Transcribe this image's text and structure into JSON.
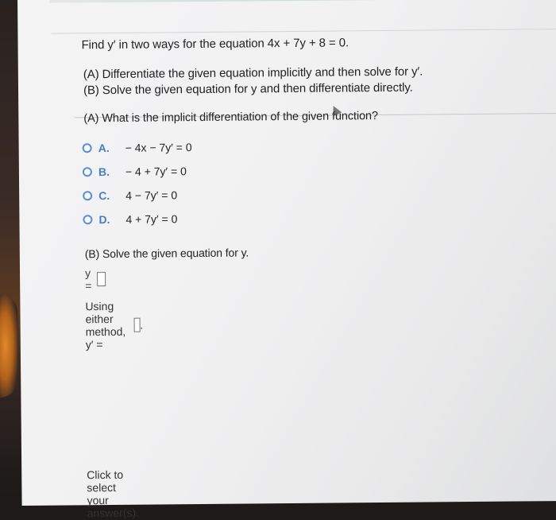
{
  "question": {
    "prompt": "Find y′ in two ways for the equation 4x + 7y + 8 = 0.",
    "part_a": "(A) Differentiate the given equation implicitly and then solve for y′.",
    "part_b": "(B) Solve the given equation for y and then differentiate directly."
  },
  "section_a": {
    "heading": "(A) What is the implicit differentiation of the given function?",
    "options": [
      {
        "letter": "A.",
        "equation": "− 4x − 7y′ = 0"
      },
      {
        "letter": "B.",
        "equation": "− 4 + 7y′ = 0"
      },
      {
        "letter": "C.",
        "equation": "4 − 7y′ = 0"
      },
      {
        "letter": "D.",
        "equation": "4 + 7y′ = 0"
      }
    ]
  },
  "section_b": {
    "heading": "(B) Solve the given equation for y.",
    "y_label": "y =",
    "method_label": "Using either method, y′ =",
    "method_suffix": "."
  },
  "footer": {
    "instruction": "Click to select your answer(s)."
  },
  "colors": {
    "radio_border": "#5a8fd3",
    "option_letter": "#4a7cc4"
  }
}
